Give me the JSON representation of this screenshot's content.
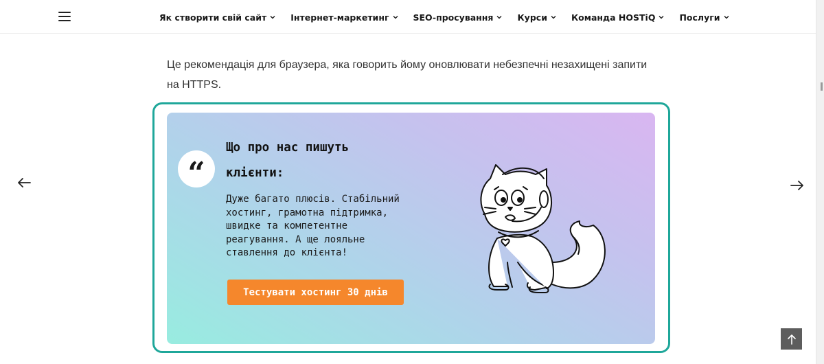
{
  "nav": {
    "items": [
      {
        "label": "Як створити свій сайт"
      },
      {
        "label": "Інтернет-маркетинг"
      },
      {
        "label": "SEO-просування"
      },
      {
        "label": "Курси"
      },
      {
        "label": "Команда HOSTiQ"
      },
      {
        "label": "Послуги"
      }
    ]
  },
  "article": {
    "paragraph": "Це рекомендація для браузера, яка говорить йому оновлювати небезпечні незахищені запити на HTTPS."
  },
  "testimonial": {
    "quote_mark": "“",
    "title": "Що про нас пишуть клієнти:",
    "text": "Дуже багато плюсів. Стабільний хостинг, грамотна підтримка, швидке та компетентне реагування. А ще лояльне ставлення до клієнта!",
    "cta_label": "Тестувати хостинг 30 днів"
  },
  "colors": {
    "frame": "#1fa79a",
    "cta": "#f5872c",
    "gradient_start": "#98ece0",
    "gradient_end": "#d9b6f1"
  },
  "icons": {
    "menu": "hamburger-icon",
    "prev": "arrow-left-icon",
    "next": "arrow-right-icon",
    "back_to_top": "arrow-up-icon",
    "illustration": "cat-with-headset-illustration"
  }
}
